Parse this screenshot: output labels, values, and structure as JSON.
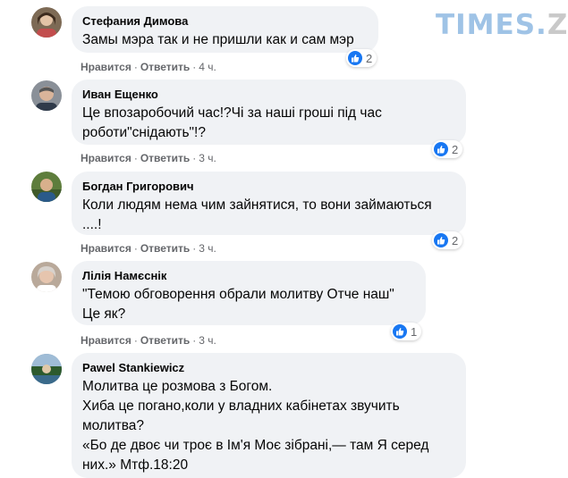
{
  "watermark": {
    "main": "TIMES.",
    "suffix": "ZT"
  },
  "comments": [
    {
      "author": "Стефания Димова",
      "lines": [
        "Замы мэра так и не пришли как и сам мэр"
      ],
      "reactions": "2",
      "like_label": "Нравится",
      "reply_label": "Ответить",
      "time": "4 ч."
    },
    {
      "author": "Иван Ещенко",
      "lines": [
        "Це впозаробочий час!?Чі за наші гроші під час",
        "роботи\"снідають\"!?"
      ],
      "reactions": "2",
      "like_label": "Нравится",
      "reply_label": "Ответить",
      "time": "3 ч."
    },
    {
      "author": "Богдан Григорович",
      "lines": [
        "Коли людям нема чим зайнятися, то вони займаються",
        "....!"
      ],
      "reactions": "2",
      "like_label": "Нравится",
      "reply_label": "Ответить",
      "time": "3 ч."
    },
    {
      "author": "Лілія Намєснік",
      "lines": [
        "\"Темою обговорення обрали молитву Отче наш\"",
        "Це як?"
      ],
      "reactions": "1",
      "like_label": "Нравится",
      "reply_label": "Ответить",
      "time": "3 ч."
    },
    {
      "author": "Pawel Stankiewicz",
      "lines": [
        "Молитва це розмова з Богом.",
        "Хиба це погано,коли у владних кабінетах звучить",
        "молитва?",
        "«Бо де двоє чи троє в Ім'я Моє зібрані,— там Я серед",
        "них.» Мтф.18:20"
      ]
    }
  ]
}
